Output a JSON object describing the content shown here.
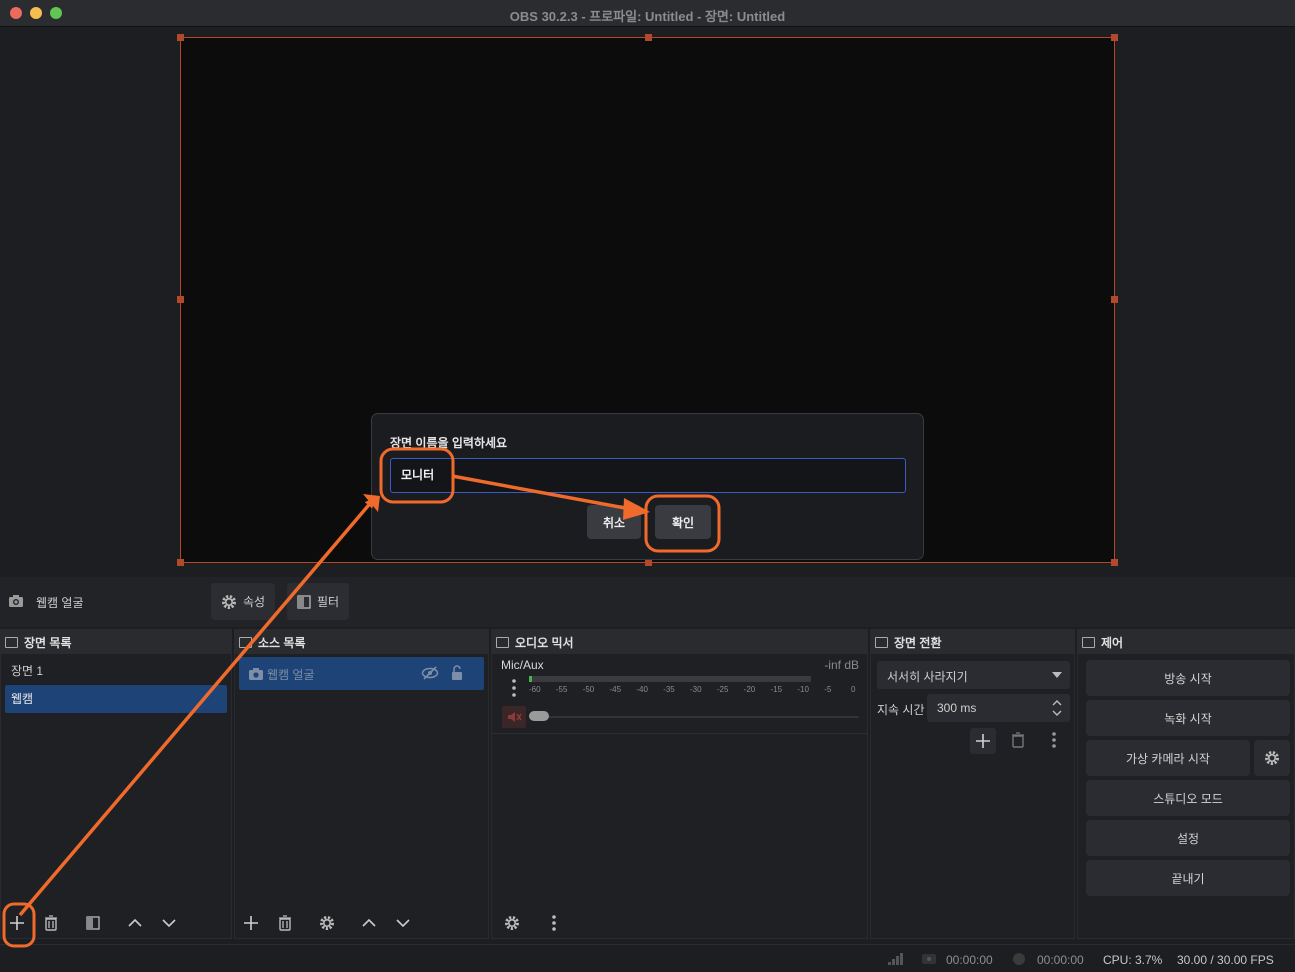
{
  "window": {
    "title": "OBS 30.2.3 - 프로파일: Untitled - 장면: Untitled"
  },
  "source_toolbar": {
    "source_name": "웹캠 얼굴",
    "properties_label": "속성",
    "filters_label": "필터"
  },
  "scenes": {
    "title": "장면 목록",
    "items": [
      "장면 1",
      "웹캠"
    ],
    "selected_index": 1
  },
  "sources": {
    "title": "소스 목록",
    "items": [
      "웹캠 얼굴"
    ]
  },
  "mixer": {
    "title": "오디오 믹서",
    "channel_name": "Mic/Aux",
    "level": "-inf dB",
    "ticks": [
      "-60",
      "-55",
      "-50",
      "-45",
      "-40",
      "-35",
      "-30",
      "-25",
      "-20",
      "-15",
      "-10",
      "-5",
      "0"
    ]
  },
  "transitions": {
    "title": "장면 전환",
    "selected": "서서히 사라지기",
    "duration_label": "지속 시간",
    "duration_value": "300 ms"
  },
  "controls": {
    "title": "제어",
    "start_stream": "방송 시작",
    "start_record": "녹화 시작",
    "start_virtual_cam": "가상 카메라 시작",
    "studio_mode": "스튜디오 모드",
    "settings": "설정",
    "exit": "끝내기"
  },
  "status": {
    "stream_time": "00:00:00",
    "record_time": "00:00:00",
    "cpu": "CPU: 3.7%",
    "fps": "30.00 / 30.00 FPS"
  },
  "dialog": {
    "label": "장면 이름을 입력하세요",
    "input_value": "모니터",
    "cancel": "취소",
    "ok": "확인"
  },
  "colors": {
    "accent_orange": "#f06a2c",
    "selection_blue": "#1e4377",
    "canvas_border": "#b2492b"
  }
}
